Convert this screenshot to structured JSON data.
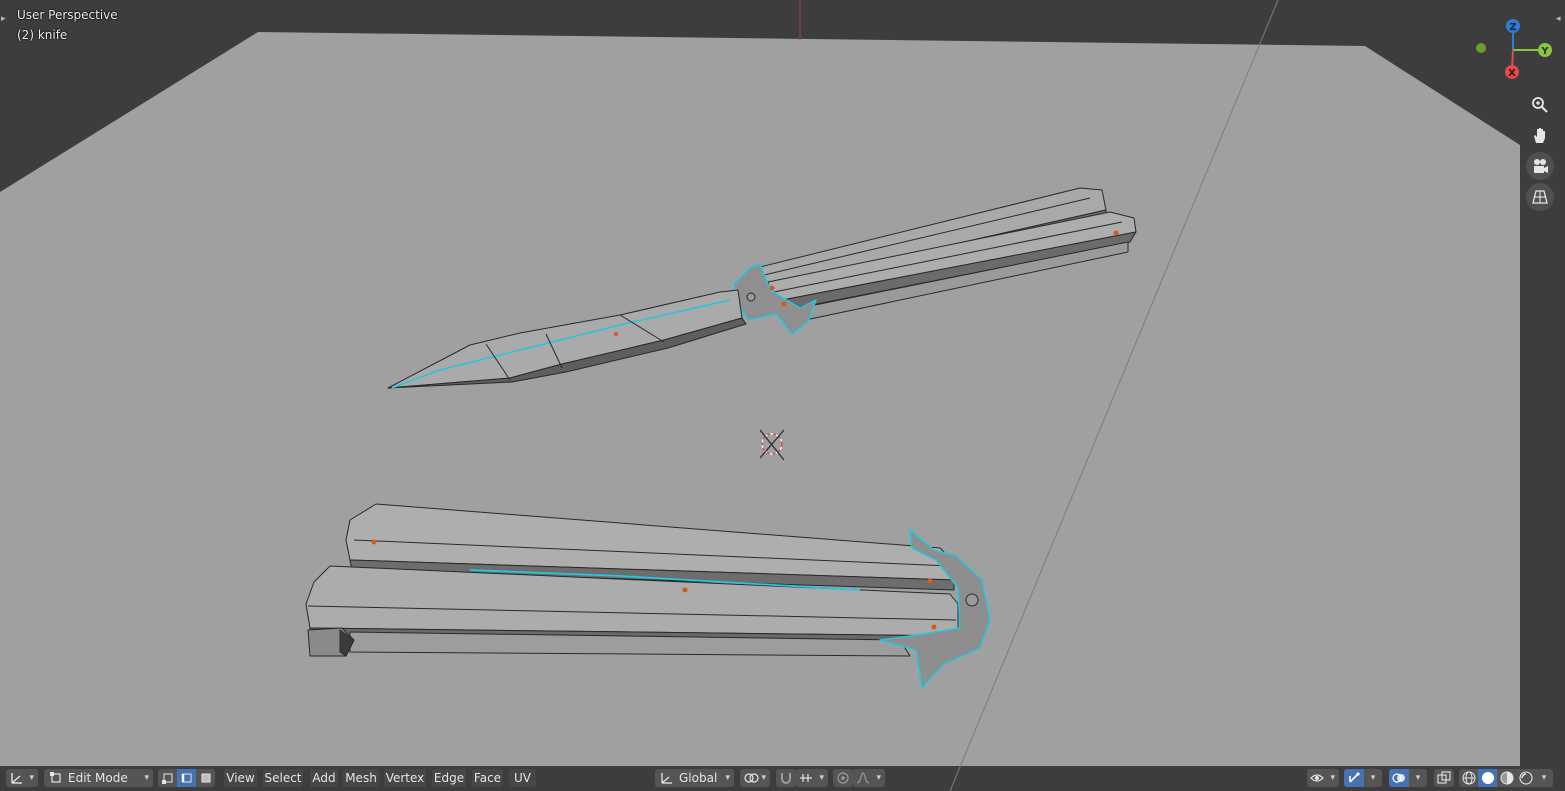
{
  "viewport": {
    "view_name": "User Perspective",
    "object_label": "(2) knife"
  },
  "gizmo": {
    "axes": [
      {
        "label": "Z",
        "color": "#2f7cd6"
      },
      {
        "label": "Y",
        "color": "#8bc53f"
      },
      {
        "label": "X",
        "color": "#e04b4b"
      }
    ],
    "negative_y_color": "#6f9a2d"
  },
  "nav_buttons": [
    {
      "name": "zoom-icon"
    },
    {
      "name": "pan-hand-icon"
    },
    {
      "name": "camera-view-icon"
    },
    {
      "name": "perspective-grid-icon"
    }
  ],
  "header": {
    "mode_label": "Edit Mode",
    "menus": [
      "View",
      "Select",
      "Add",
      "Mesh",
      "Vertex",
      "Edge",
      "Face",
      "UV"
    ],
    "orientation_label": "Global",
    "select_modes": [
      {
        "name": "vertex-select-icon",
        "active": false
      },
      {
        "name": "edge-select-icon",
        "active": true
      },
      {
        "name": "face-select-icon",
        "active": false
      }
    ]
  },
  "colors": {
    "viewport_bg": "#3d3d3d",
    "floor": "#a0a0a0",
    "mesh_face": "#a6a6a6",
    "mesh_dark": "#6e6e6e",
    "selected_edge": "#22c7e0",
    "accent": "#4772b3"
  }
}
